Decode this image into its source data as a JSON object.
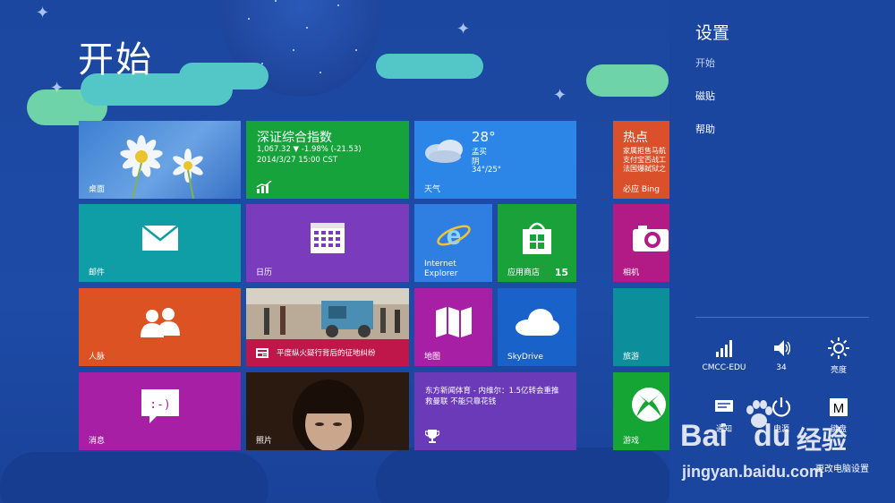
{
  "start": {
    "title": "开始",
    "tiles": {
      "desktop": {
        "label": "桌面"
      },
      "stock": {
        "title": "深证综合指数",
        "line1": "1,067.32 ▼ -1.98% (-21.53)",
        "line2": "2014/3/27 15:00 CST"
      },
      "weather": {
        "temp": "28°",
        "city": "孟买",
        "cond": "阴",
        "range": "34°/25°",
        "label": "天气"
      },
      "news": {
        "title": "热点",
        "line1": "家属拒售马航",
        "line2": "支付宝否战工",
        "line3": "法国爆弑狱之",
        "label": "必应 Bing"
      },
      "mail": {
        "label": "邮件"
      },
      "calendar": {
        "label": "日历"
      },
      "ie": {
        "label1": "Internet",
        "label2": "Explorer"
      },
      "store": {
        "label": "应用商店",
        "badge": "15"
      },
      "camera": {
        "label": "相机"
      },
      "people": {
        "label": "人脉"
      },
      "photonews": {
        "caption": "平度纵火疑行背后的征地纠纷"
      },
      "maps": {
        "label": "地图"
      },
      "skydrive": {
        "label": "SkyDrive"
      },
      "travel": {
        "label": "旅游"
      },
      "messaging": {
        "label": "消息"
      },
      "photos": {
        "label": "照片"
      },
      "sport": {
        "line1": "东方新闻体育 - 内维尔：1.5亿转会重推",
        "line2": "救曼联 不能只靠花钱"
      },
      "games": {
        "label": "游戏"
      }
    }
  },
  "charm": {
    "title": "设置",
    "subtitle": "开始",
    "links": [
      "磁贴",
      "帮助"
    ],
    "quick": {
      "network": "CMCC-EDU",
      "volume": "34",
      "brightness": "亮度",
      "notifications": "通知",
      "power": "电源",
      "keyboard": "键盘",
      "keyboard_glyph": "M"
    },
    "bottom_link": "更改电脑设置"
  },
  "watermark": {
    "brand1": "Bai",
    "brand2": "du",
    "brand_cn": "经验",
    "url": "jingyan.baidu.com"
  },
  "colors": {
    "start_bg": "#1d4aa3",
    "charm_bg": "#1b46a0",
    "accent_green": "#16a33b",
    "accent_purple": "#7a3bbd"
  }
}
